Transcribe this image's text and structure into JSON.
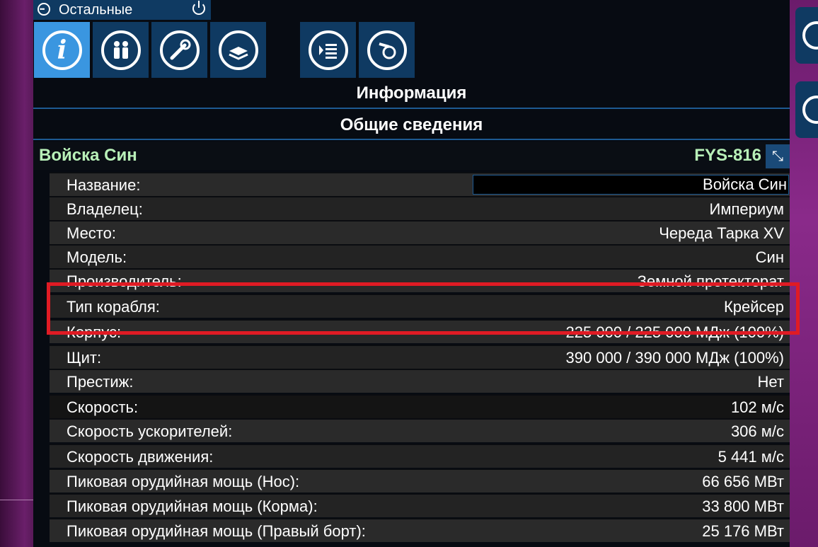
{
  "header": {
    "title": "Остальные",
    "menu_icon": "menu-dots-icon",
    "power_icon": "power-icon"
  },
  "tabs": [
    {
      "name": "info-tab",
      "icon": "info-icon",
      "active": true
    },
    {
      "name": "crew-tab",
      "icon": "people-icon",
      "active": false
    },
    {
      "name": "settings-tab",
      "icon": "wrench-icon",
      "active": false
    },
    {
      "name": "cargo-tab",
      "icon": "stack-icon",
      "active": false
    },
    {
      "name": "orders-tab",
      "icon": "list-icon",
      "active": false
    },
    {
      "name": "behavior-tab",
      "icon": "whistle-icon",
      "active": false
    }
  ],
  "section": {
    "title": "Информация",
    "subtitle": "Общие сведения"
  },
  "ship": {
    "name": "Войска Син",
    "code": "FYS-816"
  },
  "rows": [
    {
      "label": "Название:",
      "value": "Войска Син"
    },
    {
      "label": "Владелец:",
      "value": "Империум"
    },
    {
      "label": "Место:",
      "value": "Череда Тарка XV"
    },
    {
      "label": "Модель:",
      "value": "Син"
    },
    {
      "label": "Производитель:",
      "value": "Земной протекторат"
    },
    {
      "label": "Тип корабля:",
      "value": "Крейсер"
    },
    {
      "label": "Корпус:",
      "value": "225 000 / 225 000 МДж (100%)"
    },
    {
      "label": "Щит:",
      "value": "390 000 / 390 000 МДж (100%)"
    },
    {
      "label": "Престиж:",
      "value": "Нет"
    },
    {
      "label": "Скорость:",
      "value": "102 м/с"
    },
    {
      "label": "Скорость ускорителей:",
      "value": "306 м/с"
    },
    {
      "label": "Скорость движения:",
      "value": "5 441 м/с"
    },
    {
      "label": "Пиковая орудийная мощь (Нос):",
      "value": "66 656 МВт"
    },
    {
      "label": "Пиковая орудийная мощь (Корма):",
      "value": "33 800 МВт"
    },
    {
      "label": "Пиковая орудийная мощь (Правый борт):",
      "value": "25 176 МВт"
    }
  ],
  "colors": {
    "accent": "#3a96e0",
    "tab_bg": "#0f3a62",
    "ship_name": "#b8f0b8",
    "highlight": "#e01b24"
  }
}
